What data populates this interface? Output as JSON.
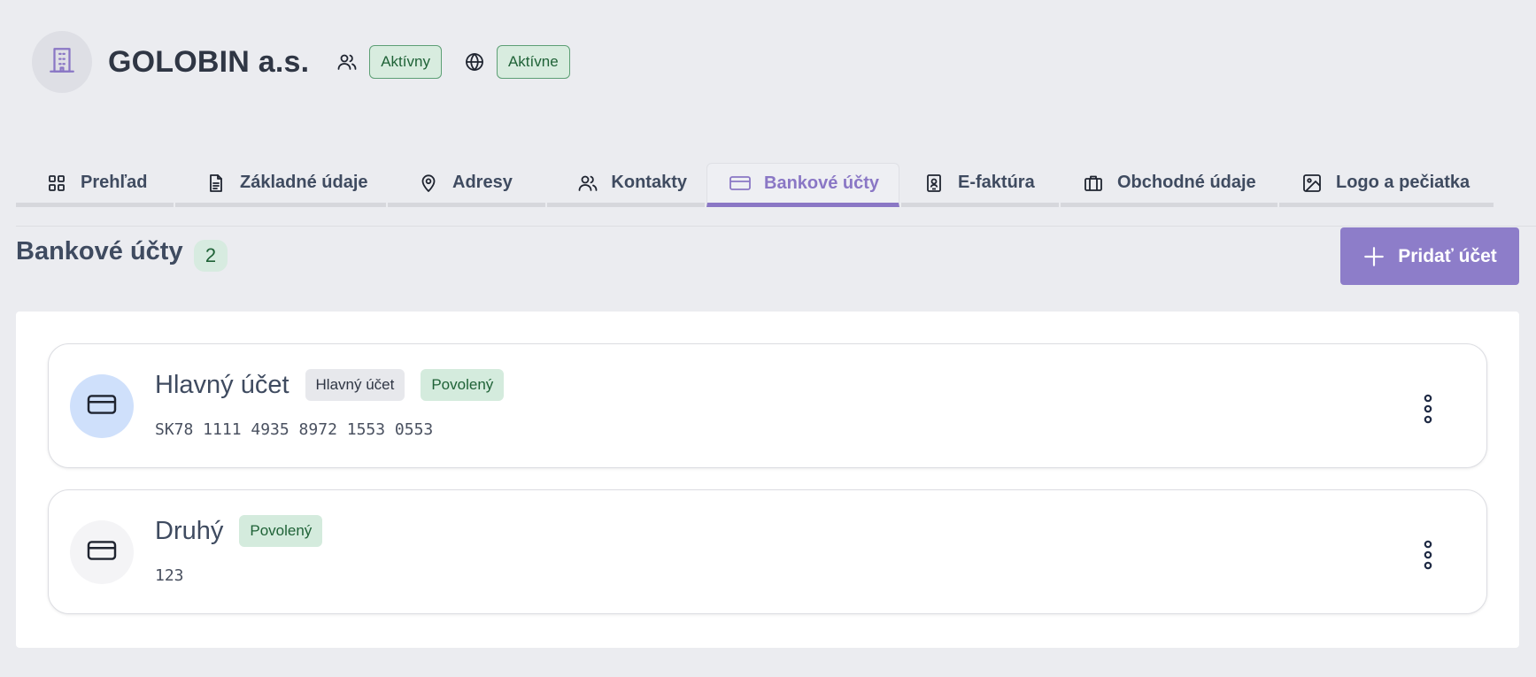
{
  "company": {
    "name": "GOLOBIN a.s.",
    "icon": "building-icon",
    "statuses": [
      {
        "icon": "users-icon",
        "label": "Aktívny"
      },
      {
        "icon": "globe-icon",
        "label": "Aktívne"
      }
    ]
  },
  "tabs": [
    {
      "label": "Prehľad",
      "icon": "grid-icon",
      "active": false
    },
    {
      "label": "Základné údaje",
      "icon": "document-icon",
      "active": false
    },
    {
      "label": "Adresy",
      "icon": "map-pin-icon",
      "active": false
    },
    {
      "label": "Kontakty",
      "icon": "users-icon",
      "active": false
    },
    {
      "label": "Bankové účty",
      "icon": "credit-card-icon",
      "active": true
    },
    {
      "label": "E-faktúra",
      "icon": "id-badge-icon",
      "active": false
    },
    {
      "label": "Obchodné údaje",
      "icon": "briefcase-icon",
      "active": false
    },
    {
      "label": "Logo a pečiatka",
      "icon": "image-icon",
      "active": false
    }
  ],
  "section": {
    "title": "Bankové účty",
    "count": "2",
    "add_label": "Pridať účet"
  },
  "accounts": [
    {
      "name": "Hlavný účet",
      "tags": [
        "Hlavný účet",
        "Povolený"
      ],
      "iban": "SK78 1111 4935 8972 1553 0553"
    },
    {
      "name": "Druhý",
      "tags": [
        "Povolený"
      ],
      "iban": "123"
    }
  ],
  "colors": {
    "accent": "#8a77c5",
    "success_bg": "#d4ebdd",
    "success_text": "#1f6237",
    "background": "#ebecf0"
  }
}
